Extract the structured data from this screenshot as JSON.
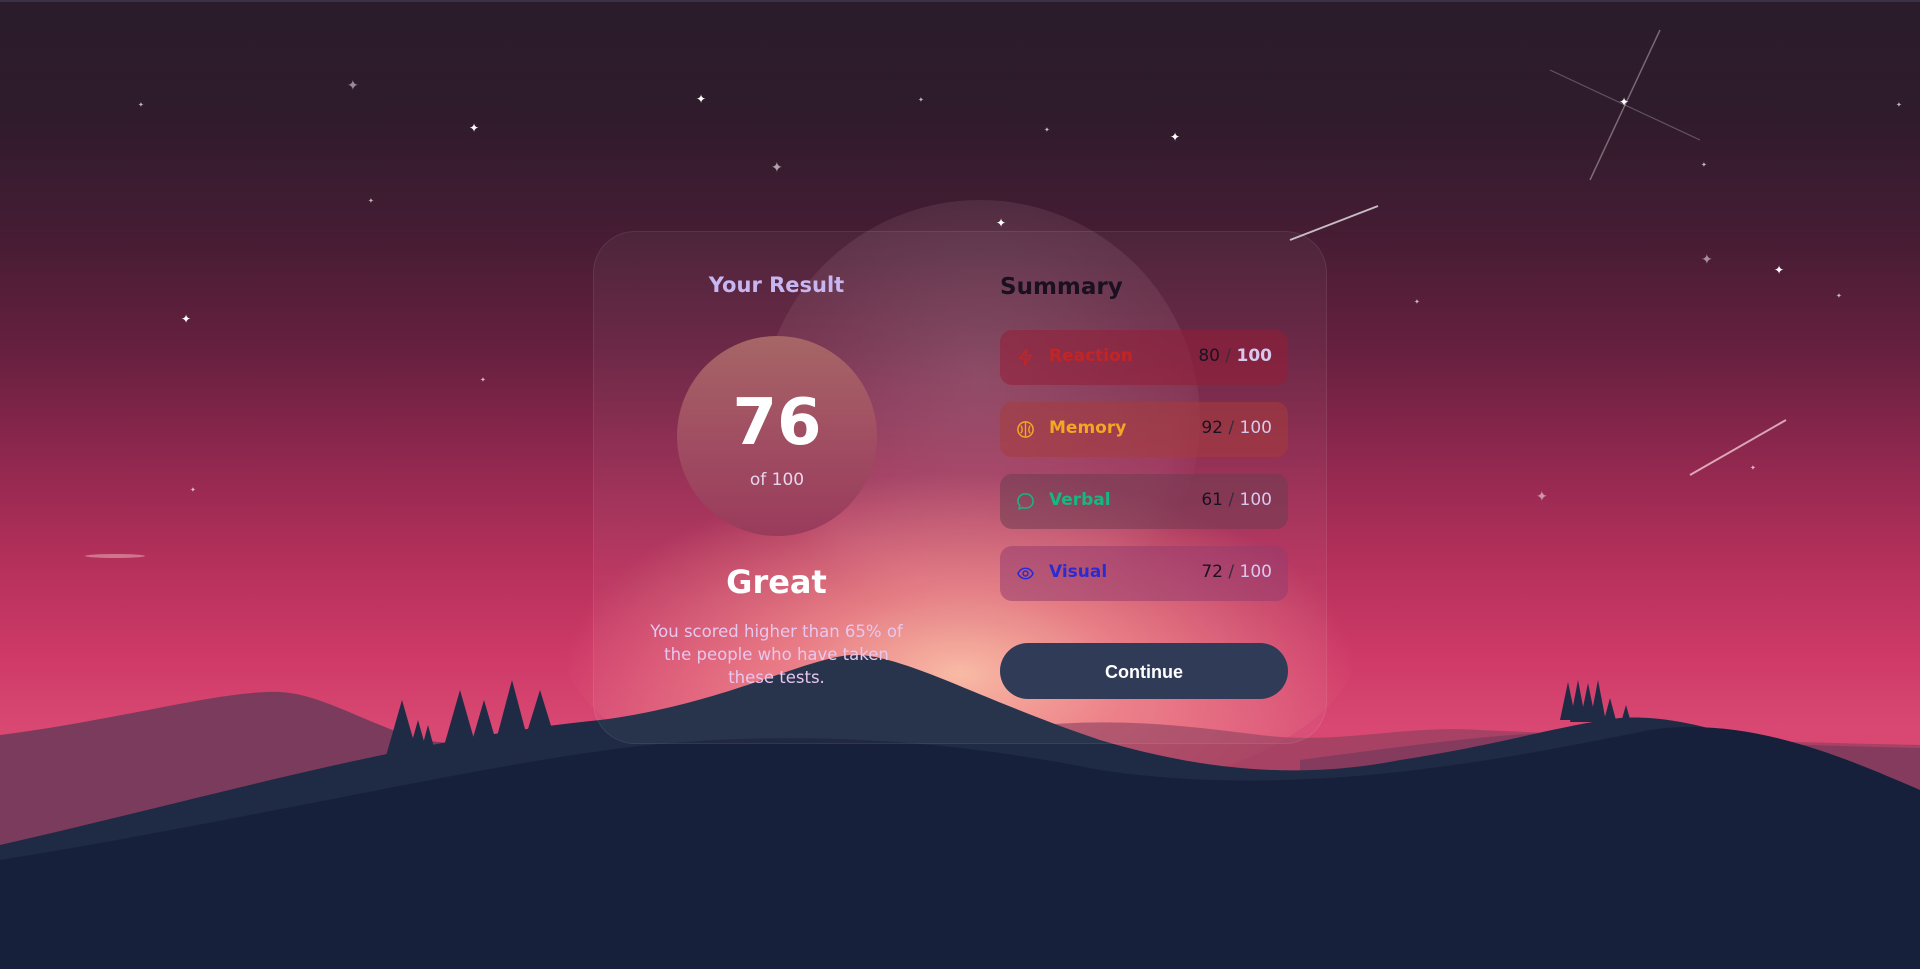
{
  "result": {
    "title": "Your Result",
    "score": "76",
    "score_of": "of 100",
    "grade": "Great",
    "description": "You scored higher than 65% of the people who have taken these tests."
  },
  "summary": {
    "title": "Summary",
    "items": [
      {
        "label": "Reaction",
        "score": "80",
        "separator": "/",
        "max": "100",
        "icon": "lightning-icon",
        "color": "#c42424"
      },
      {
        "label": "Memory",
        "score": "92",
        "separator": "/",
        "max": "100",
        "icon": "brain-icon",
        "color": "#f5a623"
      },
      {
        "label": "Verbal",
        "score": "61",
        "separator": "/",
        "max": "100",
        "icon": "chat-bubble-icon",
        "color": "#12b981"
      },
      {
        "label": "Visual",
        "score": "72",
        "separator": "/",
        "max": "100",
        "icon": "eye-icon",
        "color": "#2b2bd4"
      }
    ]
  },
  "continue_label": "Continue",
  "colors": {
    "button_bg": "#2f3b57",
    "result_title": "#c6b6f2"
  }
}
